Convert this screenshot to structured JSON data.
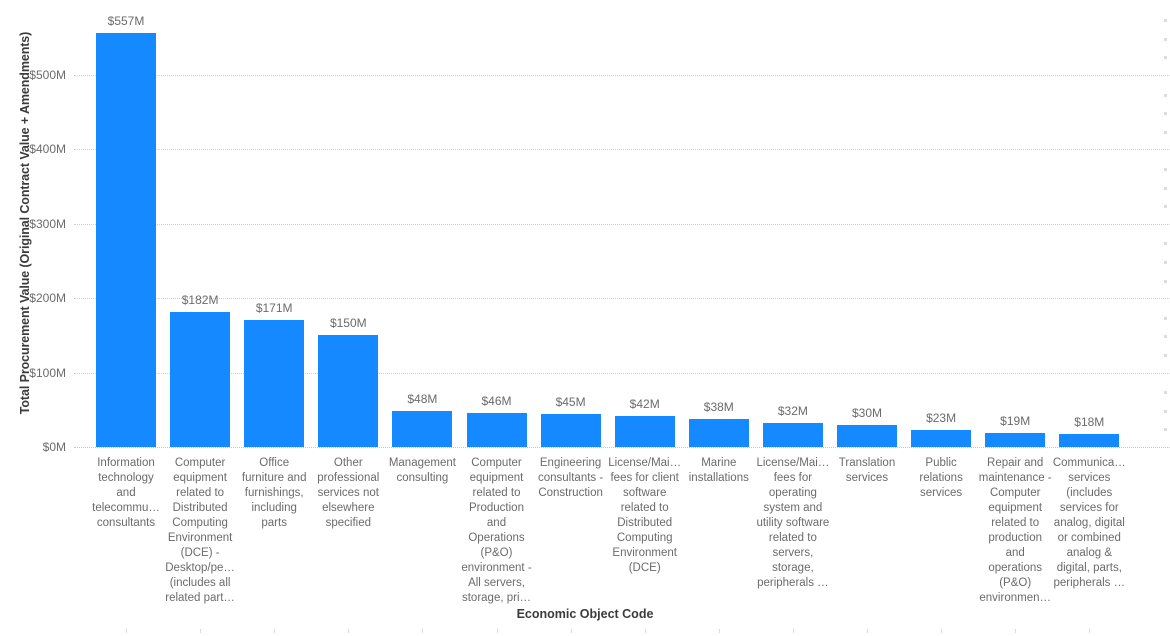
{
  "chart_data": {
    "type": "bar",
    "title": "",
    "xlabel": "Economic Object Code",
    "ylabel": "Total Procurement Value (Original Contract Value + Amendments)",
    "ylim": [
      0,
      602
    ],
    "grid": true,
    "legend": null,
    "orientation": "vertical",
    "bar_color": "#1589ff",
    "y_ticks": [
      {
        "value": 0,
        "label": "$0M"
      },
      {
        "value": 100,
        "label": "$100M"
      },
      {
        "value": 200,
        "label": "$200M"
      },
      {
        "value": 300,
        "label": "$300M"
      },
      {
        "value": 400,
        "label": "$400M"
      },
      {
        "value": 500,
        "label": "$500M"
      }
    ],
    "categories": [
      "Information technology and telecommu… consultants",
      "Computer equipment related to Distributed Computing Environment (DCE) - Desktop/pe… (includes all related part…",
      "Office furniture and furnishings, including parts",
      "Other professional services not elsewhere specified",
      "Management consulting",
      "Computer equipment related to Production and Operations (P&O) environment - All servers, storage, pri…",
      "Engineering consultants - Construction",
      "License/Mai… fees for client software related to Distributed Computing Environment (DCE)",
      "Marine installations",
      "License/Mai… fees for operating system and utility software related to servers, storage, peripherals …",
      "Translation services",
      "Public relations services",
      "Repair and maintenance - Computer equipment related to production and operations (P&O) environmen…",
      "Communica… services (includes services for analog, digital or combined analog & digital, parts, peripherals …"
    ],
    "values": [
      557,
      182,
      171,
      150,
      48,
      46,
      45,
      42,
      38,
      32,
      30,
      23,
      19,
      18
    ],
    "value_labels": [
      "$557M",
      "$182M",
      "$171M",
      "$150M",
      "$48M",
      "$46M",
      "$45M",
      "$42M",
      "$38M",
      "$32M",
      "$30M",
      "$23M",
      "$19M",
      "$18M"
    ]
  }
}
